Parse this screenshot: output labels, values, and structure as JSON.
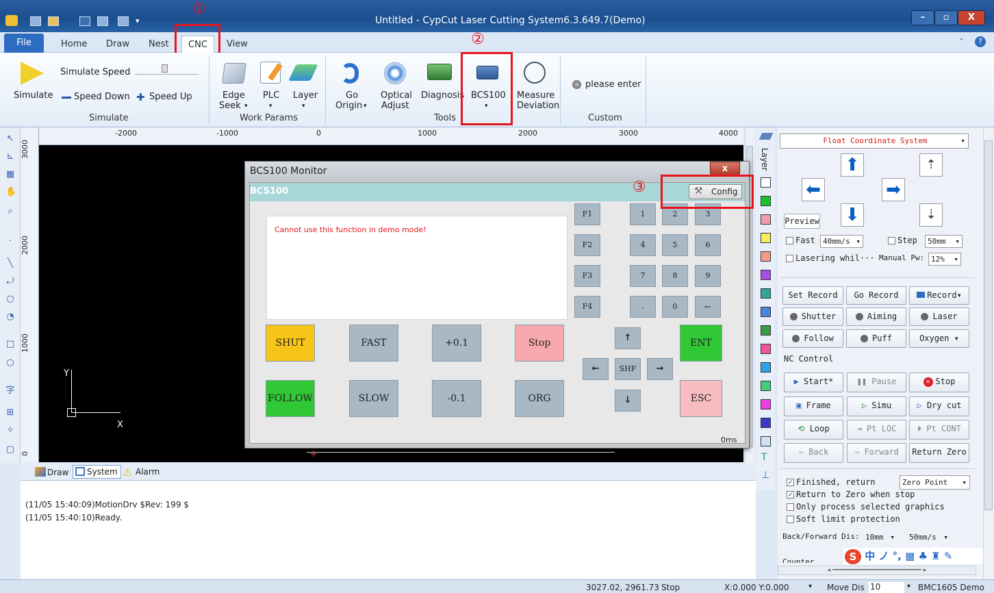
{
  "window": {
    "title": "Untitled - CypCut Laser Cutting System6.3.649.7(Demo)",
    "controls": [
      "–",
      "▫",
      "X"
    ]
  },
  "menu_tabs": {
    "file": "File",
    "home": "Home",
    "draw": "Draw",
    "nest": "Nest",
    "cnc": "CNC",
    "view": "View"
  },
  "ribbon": {
    "simulate": "Simulate",
    "simulate_speed": "Simulate Speed",
    "speed_down": "Speed Down",
    "speed_up": "Speed Up",
    "group_simulate": "Simulate",
    "edge_seek_1": "Edge",
    "edge_seek_2": "Seek",
    "plc": "PLC",
    "layer": "Layer",
    "group_work_params": "Work Params",
    "go_origin_1": "Go",
    "go_origin_2": "Origin",
    "optical_adjust_1": "Optical",
    "optical_adjust_2": "Adjust",
    "diagnosis": "Diagnosis",
    "bcs100": "BCS100",
    "measure_1": "Measure",
    "measure_2": "Deviation",
    "group_tools": "Tools",
    "please_enter": "please enter",
    "group_custom": "Custom"
  },
  "annotations": {
    "n1": "①",
    "n2": "②",
    "n3": "③"
  },
  "ruler": {
    "h": [
      "-2000",
      "-1000",
      "0",
      "1000",
      "2000",
      "3000",
      "4000"
    ],
    "v": [
      "3000",
      "2000",
      "1000",
      "0"
    ]
  },
  "canvas": {
    "axis_y": "Y",
    "axis_x": "X"
  },
  "dialog": {
    "title": "BCS100 Monitor",
    "header": "BCS100",
    "config": "Config",
    "message": "Cannot use this function in demo mode!",
    "time": "0ms",
    "fkeys": [
      "F1",
      "F2",
      "F3",
      "F4"
    ],
    "numpad": [
      "1",
      "2",
      "3",
      "4",
      "5",
      "6",
      "7",
      "8",
      "9",
      ".",
      "0",
      "←"
    ],
    "shut": "SHUT",
    "fast": "FAST",
    "plus": "+0.1",
    "stop": "Stop",
    "follow": "FOLLOW",
    "slow": "SLOW",
    "minus": "-0.1",
    "org": "ORG",
    "up": "↑",
    "left": "←",
    "shf": "SHF",
    "right": "→",
    "down": "↓",
    "ent": "ENT",
    "esc": "ESC",
    "colors": {
      "shut": "#f7c418",
      "follow": "#31c836",
      "stop": "#f7a9ad",
      "ent": "#31c836",
      "esc": "#f7bcc0",
      "gray": "#a9b8c5"
    }
  },
  "layer_label": "Layer",
  "right_panel": {
    "coord_system": "Float Coordinate System",
    "preview": "Preview",
    "fast": "Fast",
    "fast_val": "40mm/s",
    "step": "Step",
    "step_val": "50mm",
    "lasering": "Lasering whil···",
    "manual_pw": "Manual Pw:",
    "manual_pw_val": "12%",
    "set_record": "Set Record",
    "go_record": "Go Record",
    "record": "Record",
    "shutter": "Shutter",
    "aiming": "Aiming",
    "laser": "Laser",
    "follow": "Follow",
    "puff": "Puff",
    "oxygen": "Oxygen",
    "nc_control": "NC Control",
    "start": "Start*",
    "pause": "Pause",
    "stop": "Stop",
    "frame": "Frame",
    "simu": "Simu",
    "dry_cut": "Dry cut",
    "loop": "Loop",
    "pt_loc": "Pt LOC",
    "pt_cont": "Pt CONT",
    "back": "Back",
    "forward": "Forward",
    "return_zero": "Return Zero",
    "finished_return": "Finished, return",
    "zero_point": "Zero Point",
    "return_zero_stop": "Return to Zero when stop",
    "only_selected": "Only process selected graphics",
    "soft_limit": "Soft limit protection",
    "back_forward_dis": "Back/Forward Dis:",
    "bf_dist_val": "10mm",
    "bf_speed_val": "50mm/s",
    "counter": "Counter"
  },
  "bottom": {
    "tab_draw": "Draw",
    "tab_system": "System",
    "tab_alarm": "Alarm",
    "log": [
      "(11/05 15:40:09)MotionDrv $Rev: 199 $",
      "(11/05 15:40:10)Ready."
    ]
  },
  "ime": "中 ノ °, ▦ ♣ ♜ ✎",
  "status": {
    "coords": "3027.02, 2961.73",
    "state": "Stop",
    "xy": "X:0.000 Y:0.000",
    "move_dis_label": "Move Dis",
    "move_dis_val": "10",
    "device": "BMC1605 Demo"
  }
}
